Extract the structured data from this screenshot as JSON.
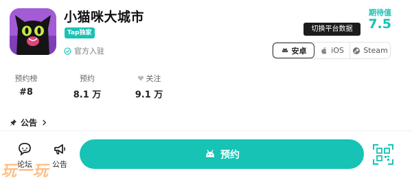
{
  "header": {
    "title": "小猫咪大城市",
    "tap_badge": "Tap独家",
    "official_label": "官方入驻",
    "rating_label": "期待值",
    "rating_value": "7.5",
    "tooltip": "切换平台数据"
  },
  "platforms": [
    {
      "label": "安卓",
      "icon": "android-icon",
      "active": true
    },
    {
      "label": "iOS",
      "icon": "apple-icon",
      "active": false
    },
    {
      "label": "Steam",
      "icon": "steam-icon",
      "active": false
    }
  ],
  "stats": [
    {
      "label": "预约榜",
      "value": "#8"
    },
    {
      "label": "预约",
      "value": "8.1 万"
    },
    {
      "label": "关注",
      "value": "9.1 万",
      "icon": "heart-icon"
    }
  ],
  "announcement": {
    "label": "公告",
    "icon": "pin-icon"
  },
  "bottom_bar": {
    "forum_label": "论坛",
    "notice_label": "公告",
    "reserve_label": "预约"
  },
  "watermark": "玩一玩",
  "colors": {
    "accent": "#16c3b5",
    "watermark": "#ff8a1f"
  }
}
